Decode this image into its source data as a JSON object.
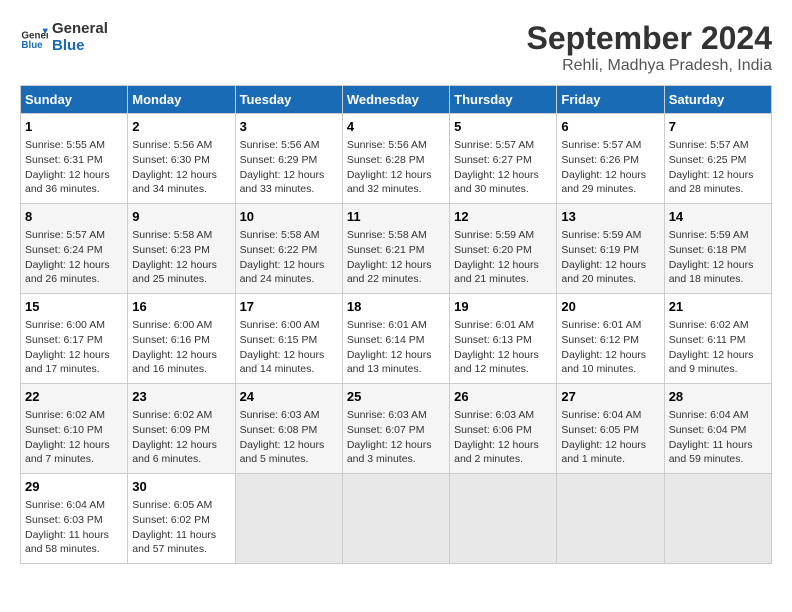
{
  "logo": {
    "text_general": "General",
    "text_blue": "Blue"
  },
  "title": "September 2024",
  "subtitle": "Rehli, Madhya Pradesh, India",
  "weekdays": [
    "Sunday",
    "Monday",
    "Tuesday",
    "Wednesday",
    "Thursday",
    "Friday",
    "Saturday"
  ],
  "weeks": [
    [
      {
        "day": "1",
        "info": "Sunrise: 5:55 AM\nSunset: 6:31 PM\nDaylight: 12 hours\nand 36 minutes."
      },
      {
        "day": "2",
        "info": "Sunrise: 5:56 AM\nSunset: 6:30 PM\nDaylight: 12 hours\nand 34 minutes."
      },
      {
        "day": "3",
        "info": "Sunrise: 5:56 AM\nSunset: 6:29 PM\nDaylight: 12 hours\nand 33 minutes."
      },
      {
        "day": "4",
        "info": "Sunrise: 5:56 AM\nSunset: 6:28 PM\nDaylight: 12 hours\nand 32 minutes."
      },
      {
        "day": "5",
        "info": "Sunrise: 5:57 AM\nSunset: 6:27 PM\nDaylight: 12 hours\nand 30 minutes."
      },
      {
        "day": "6",
        "info": "Sunrise: 5:57 AM\nSunset: 6:26 PM\nDaylight: 12 hours\nand 29 minutes."
      },
      {
        "day": "7",
        "info": "Sunrise: 5:57 AM\nSunset: 6:25 PM\nDaylight: 12 hours\nand 28 minutes."
      }
    ],
    [
      {
        "day": "8",
        "info": "Sunrise: 5:57 AM\nSunset: 6:24 PM\nDaylight: 12 hours\nand 26 minutes."
      },
      {
        "day": "9",
        "info": "Sunrise: 5:58 AM\nSunset: 6:23 PM\nDaylight: 12 hours\nand 25 minutes."
      },
      {
        "day": "10",
        "info": "Sunrise: 5:58 AM\nSunset: 6:22 PM\nDaylight: 12 hours\nand 24 minutes."
      },
      {
        "day": "11",
        "info": "Sunrise: 5:58 AM\nSunset: 6:21 PM\nDaylight: 12 hours\nand 22 minutes."
      },
      {
        "day": "12",
        "info": "Sunrise: 5:59 AM\nSunset: 6:20 PM\nDaylight: 12 hours\nand 21 minutes."
      },
      {
        "day": "13",
        "info": "Sunrise: 5:59 AM\nSunset: 6:19 PM\nDaylight: 12 hours\nand 20 minutes."
      },
      {
        "day": "14",
        "info": "Sunrise: 5:59 AM\nSunset: 6:18 PM\nDaylight: 12 hours\nand 18 minutes."
      }
    ],
    [
      {
        "day": "15",
        "info": "Sunrise: 6:00 AM\nSunset: 6:17 PM\nDaylight: 12 hours\nand 17 minutes."
      },
      {
        "day": "16",
        "info": "Sunrise: 6:00 AM\nSunset: 6:16 PM\nDaylight: 12 hours\nand 16 minutes."
      },
      {
        "day": "17",
        "info": "Sunrise: 6:00 AM\nSunset: 6:15 PM\nDaylight: 12 hours\nand 14 minutes."
      },
      {
        "day": "18",
        "info": "Sunrise: 6:01 AM\nSunset: 6:14 PM\nDaylight: 12 hours\nand 13 minutes."
      },
      {
        "day": "19",
        "info": "Sunrise: 6:01 AM\nSunset: 6:13 PM\nDaylight: 12 hours\nand 12 minutes."
      },
      {
        "day": "20",
        "info": "Sunrise: 6:01 AM\nSunset: 6:12 PM\nDaylight: 12 hours\nand 10 minutes."
      },
      {
        "day": "21",
        "info": "Sunrise: 6:02 AM\nSunset: 6:11 PM\nDaylight: 12 hours\nand 9 minutes."
      }
    ],
    [
      {
        "day": "22",
        "info": "Sunrise: 6:02 AM\nSunset: 6:10 PM\nDaylight: 12 hours\nand 7 minutes."
      },
      {
        "day": "23",
        "info": "Sunrise: 6:02 AM\nSunset: 6:09 PM\nDaylight: 12 hours\nand 6 minutes."
      },
      {
        "day": "24",
        "info": "Sunrise: 6:03 AM\nSunset: 6:08 PM\nDaylight: 12 hours\nand 5 minutes."
      },
      {
        "day": "25",
        "info": "Sunrise: 6:03 AM\nSunset: 6:07 PM\nDaylight: 12 hours\nand 3 minutes."
      },
      {
        "day": "26",
        "info": "Sunrise: 6:03 AM\nSunset: 6:06 PM\nDaylight: 12 hours\nand 2 minutes."
      },
      {
        "day": "27",
        "info": "Sunrise: 6:04 AM\nSunset: 6:05 PM\nDaylight: 12 hours\nand 1 minute."
      },
      {
        "day": "28",
        "info": "Sunrise: 6:04 AM\nSunset: 6:04 PM\nDaylight: 11 hours\nand 59 minutes."
      }
    ],
    [
      {
        "day": "29",
        "info": "Sunrise: 6:04 AM\nSunset: 6:03 PM\nDaylight: 11 hours\nand 58 minutes."
      },
      {
        "day": "30",
        "info": "Sunrise: 6:05 AM\nSunset: 6:02 PM\nDaylight: 11 hours\nand 57 minutes."
      },
      {
        "day": "",
        "info": ""
      },
      {
        "day": "",
        "info": ""
      },
      {
        "day": "",
        "info": ""
      },
      {
        "day": "",
        "info": ""
      },
      {
        "day": "",
        "info": ""
      }
    ]
  ]
}
